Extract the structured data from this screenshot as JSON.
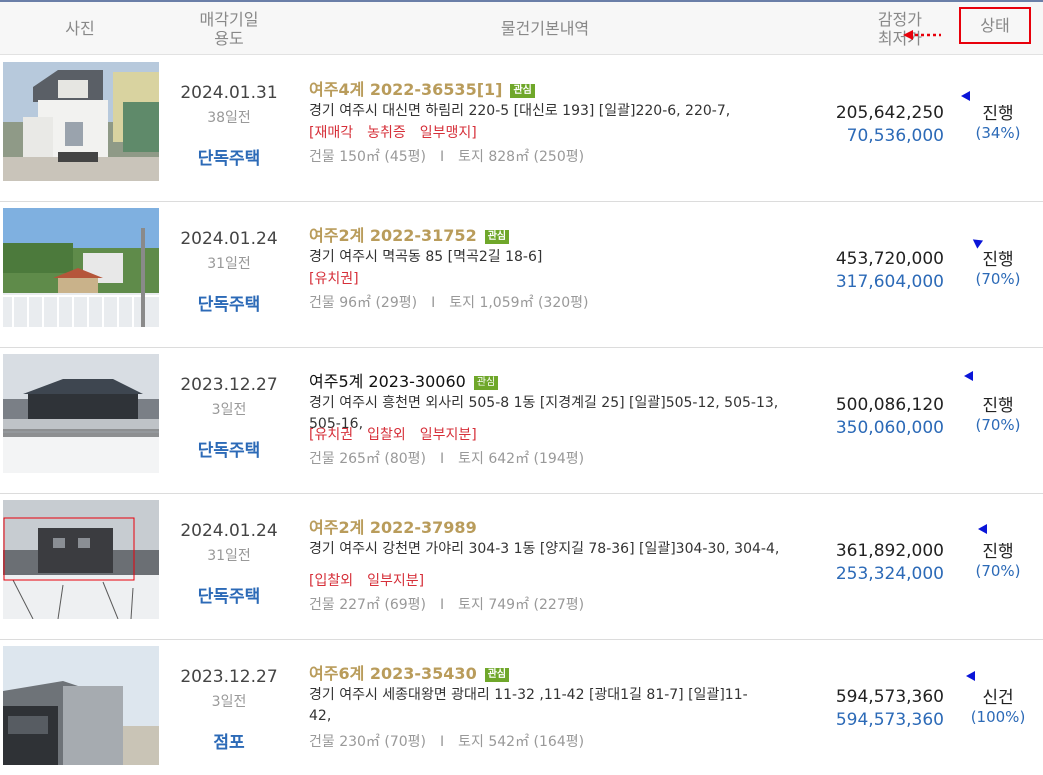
{
  "header": {
    "photo": "사진",
    "date_line1": "매각기일",
    "date_line2": "용도",
    "info": "물건기본내역",
    "price_line1": "감정가",
    "price_line2": "최저가",
    "status": "상태"
  },
  "rows": [
    {
      "date": "2024.01.31",
      "days": "38일전",
      "type": "단독주택",
      "case": "여주4계 2022-36535[1]",
      "badge": "관심",
      "address": "경기 여주시 대신면 하림리 220-5 [대신로 193]  [일괄]220-6, 220-7,",
      "tags": [
        "[재매각",
        "농취증",
        "일부맹지]"
      ],
      "building": "건물 150㎡ (45평)",
      "land": "토지 828㎡ (250평)",
      "appraisal": "205,642,250",
      "minimum": "70,536,000",
      "status": "진행",
      "rate": "(34%)"
    },
    {
      "date": "2024.01.24",
      "days": "31일전",
      "type": "단독주택",
      "case": "여주2계 2022-31752",
      "badge": "관심",
      "address": "경기 여주시 멱곡동 85 [멱곡2길 18-6]",
      "tags": [
        "[유치권]"
      ],
      "building": "건물 96㎡ (29평)",
      "land": "토지 1,059㎡ (320평)",
      "appraisal": "453,720,000",
      "minimum": "317,604,000",
      "status": "진행",
      "rate": "(70%)"
    },
    {
      "date": "2023.12.27",
      "days": "3일전",
      "type": "단독주택",
      "case": "여주5계 2023-30060",
      "badge": "관심",
      "address": "경기 여주시 흥천면 외사리 505-8 1동 [지경계길 25]  [일괄]505-12, 505-13, 505-16,",
      "tags": [
        "[유치권",
        "입찰외",
        "일부지분]"
      ],
      "building": "건물 265㎡ (80평)",
      "land": "토지 642㎡ (194평)",
      "appraisal": "500,086,120",
      "minimum": "350,060,000",
      "status": "진행",
      "rate": "(70%)"
    },
    {
      "date": "2024.01.24",
      "days": "31일전",
      "type": "단독주택",
      "case": "여주2계 2022-37989",
      "badge": "",
      "address": "경기 여주시 강천면 가야리 304-3 1동 [양지길 78-36]  [일괄]304-30, 304-4,",
      "tags": [
        "[입찰외",
        "일부지분]"
      ],
      "building": "건물 227㎡ (69평)",
      "land": "토지 749㎡ (227평)",
      "appraisal": "361,892,000",
      "minimum": "253,324,000",
      "status": "진행",
      "rate": "(70%)"
    },
    {
      "date": "2023.12.27",
      "days": "3일전",
      "type": "점포",
      "case": "여주6계 2023-35430",
      "badge": "관심",
      "address": "경기 여주시 세종대왕면 광대리 11-32 ,11-42 [광대1길 81-7]  [일괄]11-42,",
      "tags": [],
      "building": "건물 230㎡ (70평)",
      "land": "토지 542㎡ (164평)",
      "appraisal": "594,573,360",
      "minimum": "594,573,360",
      "status": "신건",
      "rate": "(100%)"
    }
  ],
  "colors": {
    "case_gold": "#b99c5b",
    "type_blue": "#2c6ab7",
    "tag_red": "#d6303a",
    "badge_green": "#6fa72a",
    "status_highlight": "#e8000b",
    "marker_blue": "#0a15d8"
  },
  "icons": {
    "status_marker": "triangle-left-icon",
    "header_arrow": "dotted-arrow-left-icon"
  }
}
